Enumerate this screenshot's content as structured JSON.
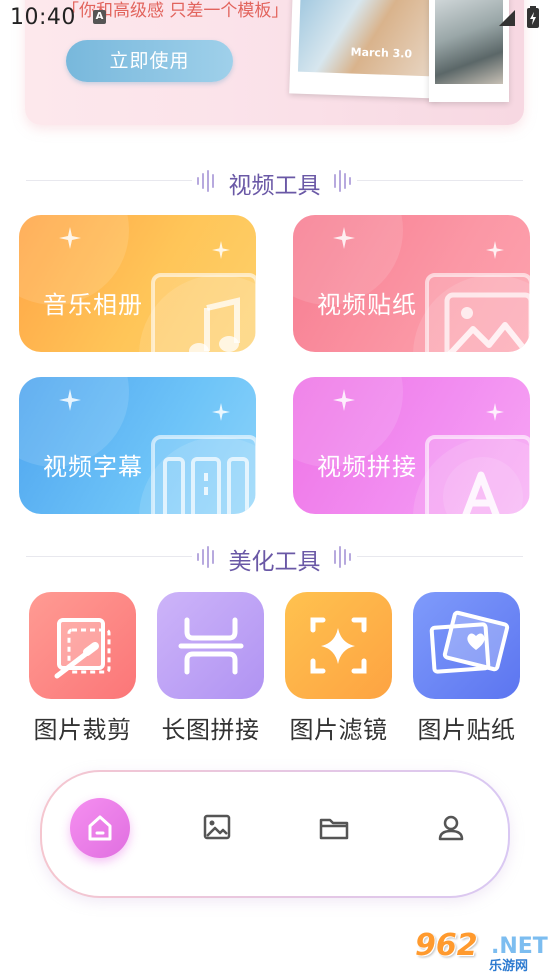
{
  "status_bar": {
    "time": "10:40",
    "notification_icon": "A"
  },
  "banner": {
    "tagline": "「你和高级感  只差一个模板」",
    "cta_label": "立即使用",
    "photo_caption": "March 3.0"
  },
  "video_tools": {
    "title": "视频工具",
    "cards": [
      {
        "label": "音乐相册",
        "icon": "music-note-icon"
      },
      {
        "label": "视频贴纸",
        "icon": "image-sticker-icon"
      },
      {
        "label": "视频字幕",
        "icon": "subtitle-icon"
      },
      {
        "label": "视频拼接",
        "icon": "text-a-icon"
      }
    ]
  },
  "beauty_tools": {
    "title": "美化工具",
    "items": [
      {
        "label": "图片裁剪",
        "icon": "crop-icon"
      },
      {
        "label": "长图拼接",
        "icon": "long-image-icon"
      },
      {
        "label": "图片滤镜",
        "icon": "filter-icon"
      },
      {
        "label": "图片贴纸",
        "icon": "photo-sticker-icon"
      }
    ]
  },
  "bottom_nav": {
    "items": [
      "home-icon",
      "gallery-icon",
      "folder-icon",
      "profile-icon"
    ],
    "active": "home"
  },
  "watermark": {
    "number": "962",
    "suffix": ".NET",
    "site": "乐游网"
  }
}
